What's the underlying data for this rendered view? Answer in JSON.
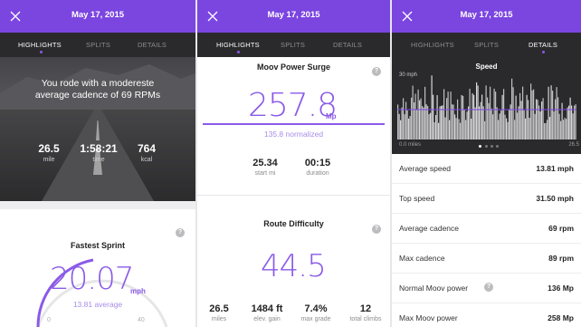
{
  "colors": {
    "accent": "#7b45e0",
    "accent_light": "#8a5ae8",
    "tab_bar": "#2a2a2c"
  },
  "screens": [
    {
      "date": "May 17, 2015",
      "tabs": [
        {
          "label": "HIGHLIGHTS",
          "active": true
        },
        {
          "label": "SPLITS",
          "active": false
        },
        {
          "label": "DETAILS",
          "active": false
        }
      ],
      "highlight_text": "You rode with a modereste average cadence of 69 RPMs",
      "stats": [
        {
          "value": "26.5",
          "label": "mile"
        },
        {
          "value": "1:58:21",
          "label": "time"
        },
        {
          "value": "764",
          "label": "kcal"
        }
      ],
      "fastest_sprint": {
        "title": "Fastest Sprint",
        "value": "20.07",
        "unit": "mph",
        "sub": "13.81 average",
        "gauge_min": "0",
        "gauge_max": "40"
      }
    },
    {
      "date": "May 17, 2015",
      "tabs": [
        {
          "label": "HIGHLIGHTS",
          "active": true
        },
        {
          "label": "SPLITS",
          "active": false
        },
        {
          "label": "DETAILS",
          "active": false
        }
      ],
      "power_surge": {
        "title": "Moov Power Surge",
        "value": "257.8",
        "unit": "Mp",
        "sub": "135.8 normalized",
        "stats": [
          {
            "value": "25.34",
            "label": "start mi"
          },
          {
            "value": "00:15",
            "label": "duration"
          }
        ]
      },
      "route_difficulty": {
        "title": "Route Difficulty",
        "value": "44.5",
        "stats": [
          {
            "value": "26.5",
            "label": "miles"
          },
          {
            "value": "1484 ft",
            "label": "elev. gain"
          },
          {
            "value": "7.4%",
            "label": "max grade"
          },
          {
            "value": "12",
            "label": "total climbs"
          }
        ]
      }
    },
    {
      "date": "May 17, 2015",
      "tabs": [
        {
          "label": "HIGHLIGHTS",
          "active": false
        },
        {
          "label": "SPLITS",
          "active": false
        },
        {
          "label": "DETAILS",
          "active": true
        }
      ],
      "chart": {
        "title": "Speed",
        "y_top_label": "30 mph",
        "x_start_label": "0.0 miles",
        "x_end_label": "26.5"
      },
      "details": [
        {
          "label": "Average speed",
          "value": "13.81 mph",
          "help": false
        },
        {
          "label": "Top speed",
          "value": "31.50 mph",
          "help": false
        },
        {
          "label": "Average cadence",
          "value": "69 rpm",
          "help": false
        },
        {
          "label": "Max cadence",
          "value": "89 rpm",
          "help": false
        },
        {
          "label": "Normal Moov power",
          "value": "136 Mp",
          "help": true
        },
        {
          "label": "Max Moov power",
          "value": "258 Mp",
          "help": false
        }
      ]
    }
  ]
}
